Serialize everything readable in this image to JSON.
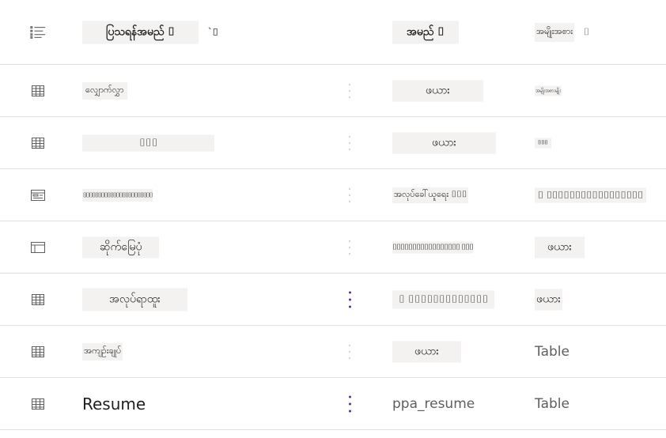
{
  "header": {
    "name_label": "ပြသရန်အမည် ⌷",
    "name_sort": "`⌷",
    "schema_label": "အမည် ⌷",
    "type_label": "အမျိုးအစား",
    "type_sort": "⌷"
  },
  "rows": [
    {
      "icon": "table-icon",
      "name": "လျှောက်လွှာ",
      "schema": "ဖယား",
      "type": "အမျိုးအစားမျိုး"
    },
    {
      "icon": "table-icon",
      "name": "⌷⌷⌷",
      "schema": "ဖယား",
      "type": "⌷⌷⌷"
    },
    {
      "icon": "form-icon",
      "name": "⌷⌷⌷⌷⌷⌷⌷⌷⌷⌷⌷⌷⌷⌷⌷⌷⌷⌷⌷⌷⌷⌷⌷",
      "schema": "အလုပ်ခေါ်ယူရေး ⌷⌷⌷",
      "type": "⌷ ⌷⌷⌷⌷⌷⌷⌷⌷⌷⌷⌷⌷⌷⌷⌷⌷⌷"
    },
    {
      "icon": "view-icon",
      "name": "ဆိုက်မြေပုံ",
      "schema": "⌷⌷⌷⌷⌷⌷⌷⌷⌷⌷⌷⌷⌷⌷⌷⌷⌷ ⌷⌷⌷",
      "type": "ဖယား"
    },
    {
      "icon": "table-icon",
      "name": "အလုပ်ရာထူး",
      "schema": "⌷ ⌷⌷⌷⌷⌷⌷⌷⌷⌷⌷⌷⌷⌷",
      "type": "ဖယား"
    },
    {
      "icon": "table-icon",
      "name": "အကျဉ်းချုပ်",
      "schema": "ဖယား",
      "type": "Table"
    },
    {
      "icon": "table-icon",
      "name": "Resume",
      "schema": "ppa_resume",
      "type": "Table"
    }
  ],
  "colors": {
    "accent": "#5c2e91",
    "divider": "#e1dfdd",
    "chip": "#f3f2f1"
  }
}
